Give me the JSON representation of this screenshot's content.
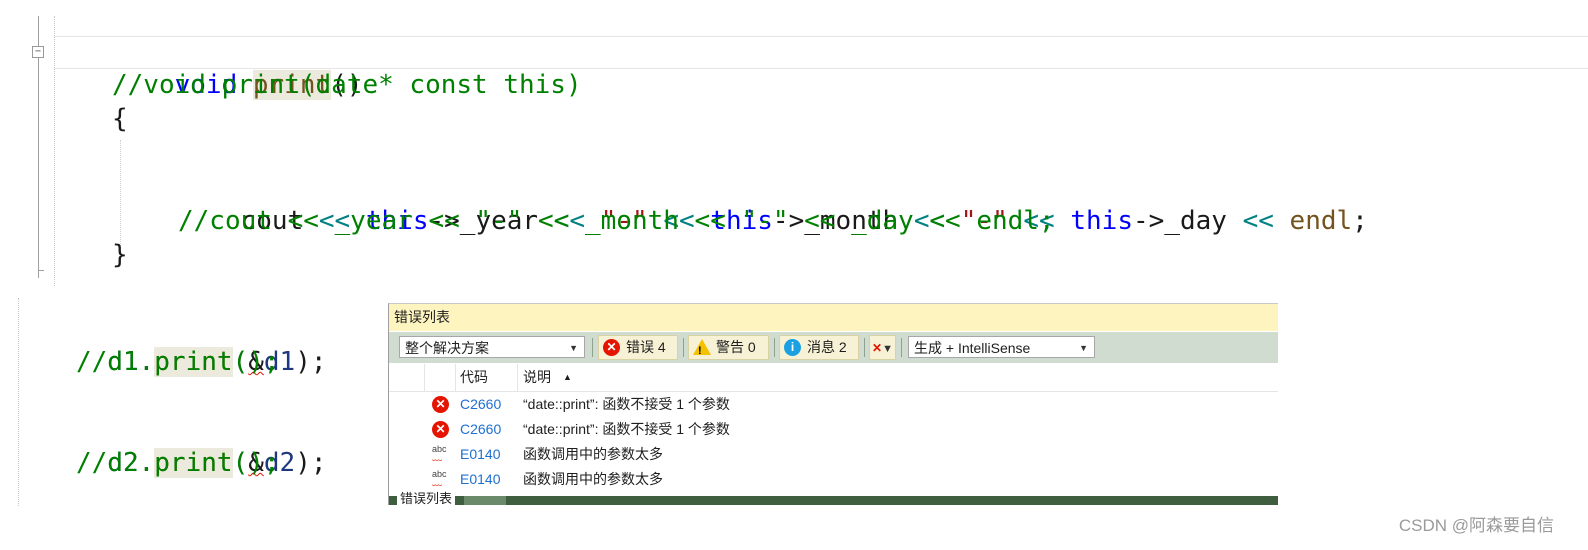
{
  "editor_top": {
    "fold_symbol": "⊟",
    "line1": {
      "kw": "void",
      "space": " ",
      "fn": "print",
      "rest": "()"
    },
    "line2": "//void print(date* const this)",
    "line3": "{",
    "line4": {
      "a": "cout",
      "b": " ",
      "c": "<<",
      "d": " ",
      "e": "this",
      "f": "->_year ",
      "g": "<<",
      "h": " ",
      "i": "\"-\"",
      "j": " ",
      "k": "<<",
      "l": " ",
      "m": "this",
      "n": "->_month ",
      "o": "<<",
      "p": " ",
      "q": "\"-\"",
      "r": " ",
      "s": "<<",
      "t": " ",
      "u": "this",
      "v": "->_day ",
      "w": "<<",
      "x": " ",
      "y": "endl",
      "z": ";"
    },
    "line5": "//cout << _year << \"-\" << _month << \"-\" << _day << endl;",
    "line6": "}"
  },
  "editor_bottom": {
    "line1": {
      "obj": "d1",
      "dot": ".",
      "fn": "print",
      "open": "(",
      "amp": "&",
      "arg": "d1",
      "close": ");"
    },
    "line2": "//d1.print();",
    "line3": {
      "obj": "d2",
      "dot": ".",
      "fn": "print",
      "open": "(",
      "amp": "&",
      "arg": "d2",
      "close": ");"
    },
    "line4": "//d2.print();"
  },
  "error_list": {
    "title": "错误列表",
    "scope_dropdown": "整个解决方案",
    "errors_btn": "错误 4",
    "warnings_btn": "警告 0",
    "messages_btn": "消息 2",
    "build_dropdown": "生成 + IntelliSense",
    "col_code": "代码",
    "col_desc": "说明",
    "sort_arrow": "▲",
    "rows": [
      {
        "icon": "error-icon",
        "code": "C2660",
        "desc": "“date::print”: 函数不接受 1 个参数"
      },
      {
        "icon": "error-icon",
        "code": "C2660",
        "desc": "“date::print”: 函数不接受 1 个参数"
      },
      {
        "icon": "intellisense-icon",
        "code": "E0140",
        "desc": "函数调用中的参数太多"
      },
      {
        "icon": "intellisense-icon",
        "code": "E0140",
        "desc": "函数调用中的参数太多"
      }
    ],
    "bottom_tab": "错误列表"
  },
  "watermark": "CSDN @阿森要自信",
  "colors": {
    "keyword": "#0000ff",
    "comment": "#008000",
    "string": "#a31515",
    "operator": "#008080",
    "error_red": "#e51400",
    "panel_title_bg": "#fdf4bf",
    "toolbar_bg": "#cfdccf"
  }
}
